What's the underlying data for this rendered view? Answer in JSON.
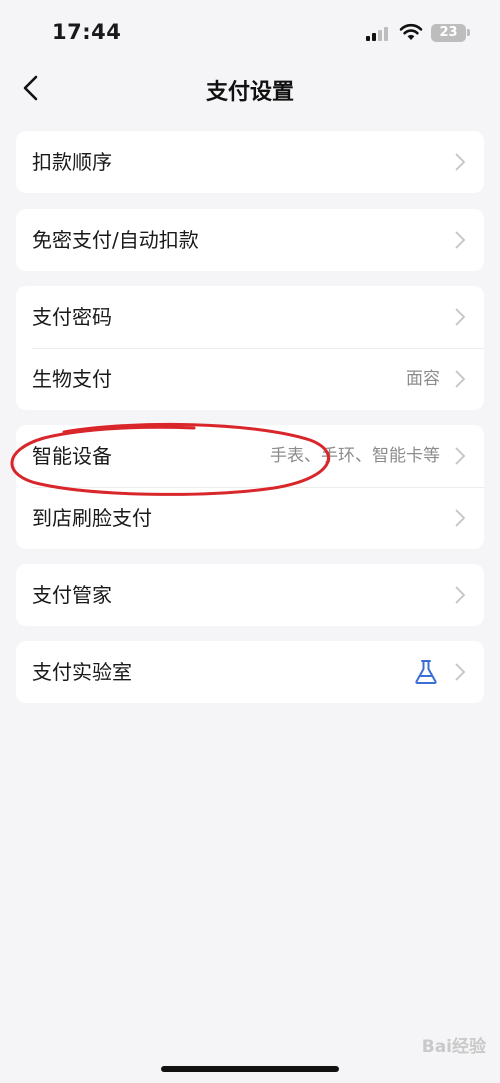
{
  "status_bar": {
    "time": "17:44",
    "battery": "23"
  },
  "nav": {
    "title": "支付设置"
  },
  "groups": [
    {
      "rows": [
        {
          "label": "扣款顺序",
          "value": ""
        }
      ]
    },
    {
      "rows": [
        {
          "label": "免密支付/自动扣款",
          "value": ""
        }
      ]
    },
    {
      "rows": [
        {
          "label": "支付密码",
          "value": ""
        },
        {
          "label": "生物支付",
          "value": "面容"
        }
      ]
    },
    {
      "rows": [
        {
          "label": "智能设备",
          "value": "手表、手环、智能卡等"
        },
        {
          "label": "到店刷脸支付",
          "value": ""
        }
      ]
    },
    {
      "rows": [
        {
          "label": "支付管家",
          "value": ""
        }
      ]
    },
    {
      "rows": [
        {
          "label": "支付实验室",
          "value": "",
          "icon": "flask-icon"
        }
      ]
    }
  ],
  "watermark": "Bai经验",
  "colors": {
    "background": "#f5f5f7",
    "card": "#ffffff",
    "accent_icon": "#3b6fd6",
    "annotation": "#d9262b"
  }
}
